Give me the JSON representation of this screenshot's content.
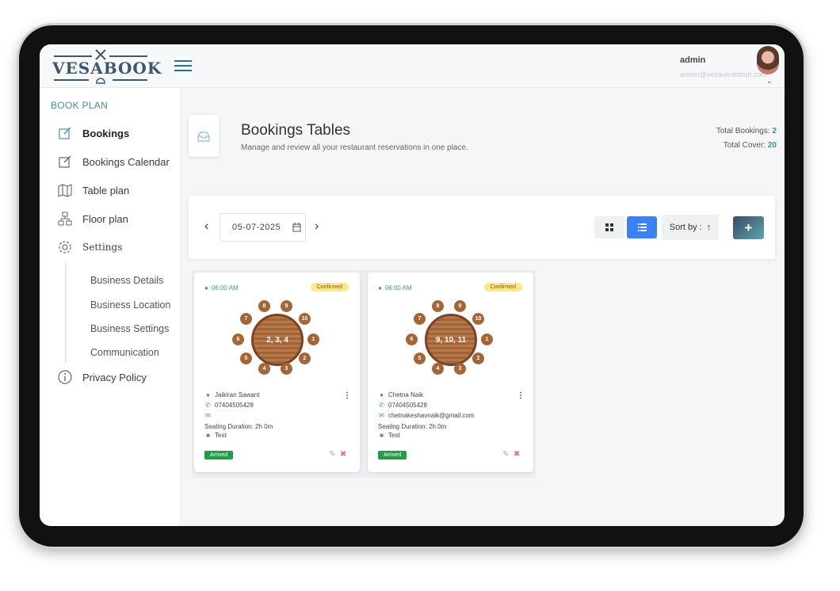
{
  "header": {
    "logo_text": "VESABOOK",
    "user_name": "admin",
    "user_email": "admin@vesawinfotech.com"
  },
  "sidebar": {
    "heading": "BOOK PLAN",
    "items": [
      {
        "label": "Bookings",
        "icon": "edit-icon",
        "active": true
      },
      {
        "label": "Bookings Calendar",
        "icon": "edit-icon"
      },
      {
        "label": "Table plan",
        "icon": "map-icon"
      },
      {
        "label": "Floor plan",
        "icon": "sitemap-icon"
      },
      {
        "label": "Settings",
        "icon": "gear-icon"
      },
      {
        "label": "Privacy Policy",
        "icon": "info-icon"
      }
    ],
    "settings_sub": [
      "Business Details",
      "Business Location",
      "Business Settings",
      "Communication"
    ]
  },
  "page": {
    "title": "Bookings Tables",
    "subtitle": "Manage and review all your restaurant reservations in one place.",
    "total_bookings_label": "Total Bookings:",
    "total_bookings": "2",
    "total_cover_label": "Total Cover:",
    "total_cover": "20"
  },
  "toolbar": {
    "date": "05-07-2025",
    "sort_label": "Sort by :",
    "add_label": "+"
  },
  "bookings": [
    {
      "time": "06:00 AM",
      "status": "Confirmed",
      "tables": "2, 3, 4",
      "seats": [
        "1",
        "2",
        "3",
        "4",
        "5",
        "6",
        "7",
        "8",
        "9",
        "10"
      ],
      "name": "Jaikiran Sawant",
      "phone": "07404505428",
      "email": "",
      "duration": "Seating Duration: 2h 0m",
      "note": "Test",
      "arrival": "Arrived"
    },
    {
      "time": "06:00 AM",
      "status": "Confirmed",
      "tables": "9, 10, 11",
      "seats": [
        "1",
        "2",
        "3",
        "4",
        "5",
        "6",
        "7",
        "8",
        "9",
        "10"
      ],
      "name": "Chetna Naik",
      "phone": "07404505428",
      "email": "chetnakeshavnaik@gmail.com",
      "duration": "Seating Duration: 2h 0m",
      "note": "Test",
      "arrival": "Arrived"
    }
  ],
  "colors": {
    "accent": "#3b82f6",
    "brand": "#3d5671",
    "confirmed": "#fde98a",
    "arrived": "#1f9d4a",
    "seat": "#a56637"
  }
}
